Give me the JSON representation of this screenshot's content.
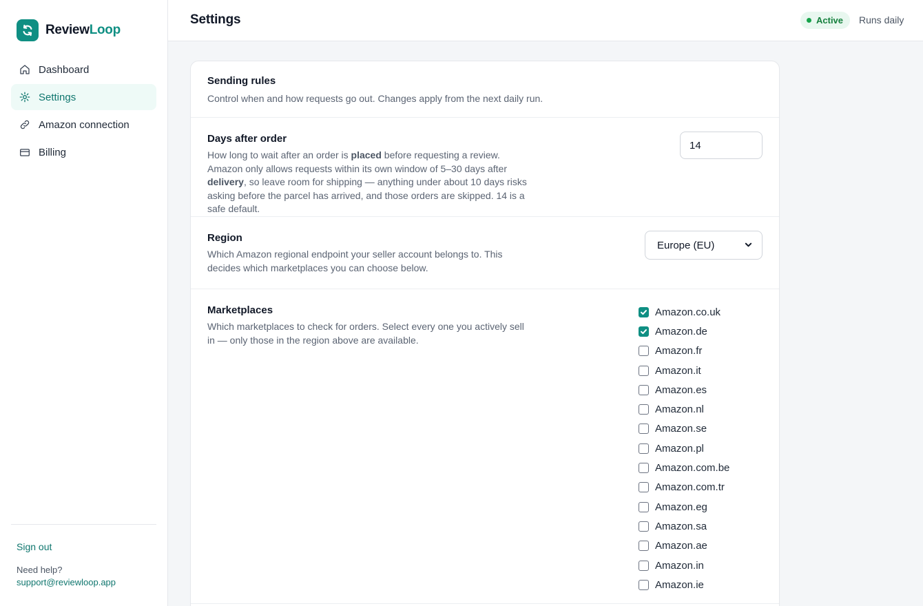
{
  "brand": {
    "name_part1": "Review",
    "name_part2": "Loop",
    "accent": "#0f8f83"
  },
  "nav": {
    "items": [
      {
        "label": "Dashboard",
        "icon": "home-icon",
        "active": false
      },
      {
        "label": "Settings",
        "icon": "gear-icon",
        "active": true
      },
      {
        "label": "Amazon connection",
        "icon": "link-icon",
        "active": false
      },
      {
        "label": "Billing",
        "icon": "credit-card-icon",
        "active": false
      }
    ]
  },
  "sidebar_footer": {
    "sign_out": "Sign out",
    "help_label": "Need help?",
    "help_email": "support@reviewloop.app"
  },
  "header": {
    "title": "Settings",
    "status": "Active",
    "schedule": "Runs daily"
  },
  "sending_rules": {
    "title": "Sending rules",
    "subtitle": "Control when and how requests go out. Changes apply from the next daily run."
  },
  "days_after_order": {
    "title": "Days after order",
    "desc_1": "How long to wait after an order is ",
    "desc_bold_1": "placed",
    "desc_2": " before requesting a review. Amazon only allows requests within its own window of 5–30 days after ",
    "desc_bold_2": "delivery",
    "desc_3": ", so leave room for shipping — anything under about 10 days risks asking before the parcel has arrived, and those orders are skipped. 14 is a safe default.",
    "value": "14"
  },
  "region": {
    "title": "Region",
    "desc": "Which Amazon regional endpoint your seller account belongs to. This decides which marketplaces you can choose below.",
    "selected": "Europe (EU)"
  },
  "marketplaces": {
    "title": "Marketplaces",
    "desc": "Which marketplaces to check for orders. Select every one you actively sell in — only those in the region above are available.",
    "items": [
      {
        "label": "Amazon.co.uk",
        "checked": true
      },
      {
        "label": "Amazon.de",
        "checked": true
      },
      {
        "label": "Amazon.fr",
        "checked": false
      },
      {
        "label": "Amazon.it",
        "checked": false
      },
      {
        "label": "Amazon.es",
        "checked": false
      },
      {
        "label": "Amazon.nl",
        "checked": false
      },
      {
        "label": "Amazon.se",
        "checked": false
      },
      {
        "label": "Amazon.pl",
        "checked": false
      },
      {
        "label": "Amazon.com.be",
        "checked": false
      },
      {
        "label": "Amazon.com.tr",
        "checked": false
      },
      {
        "label": "Amazon.eg",
        "checked": false
      },
      {
        "label": "Amazon.sa",
        "checked": false
      },
      {
        "label": "Amazon.ae",
        "checked": false
      },
      {
        "label": "Amazon.in",
        "checked": false
      },
      {
        "label": "Amazon.ie",
        "checked": false
      }
    ]
  }
}
